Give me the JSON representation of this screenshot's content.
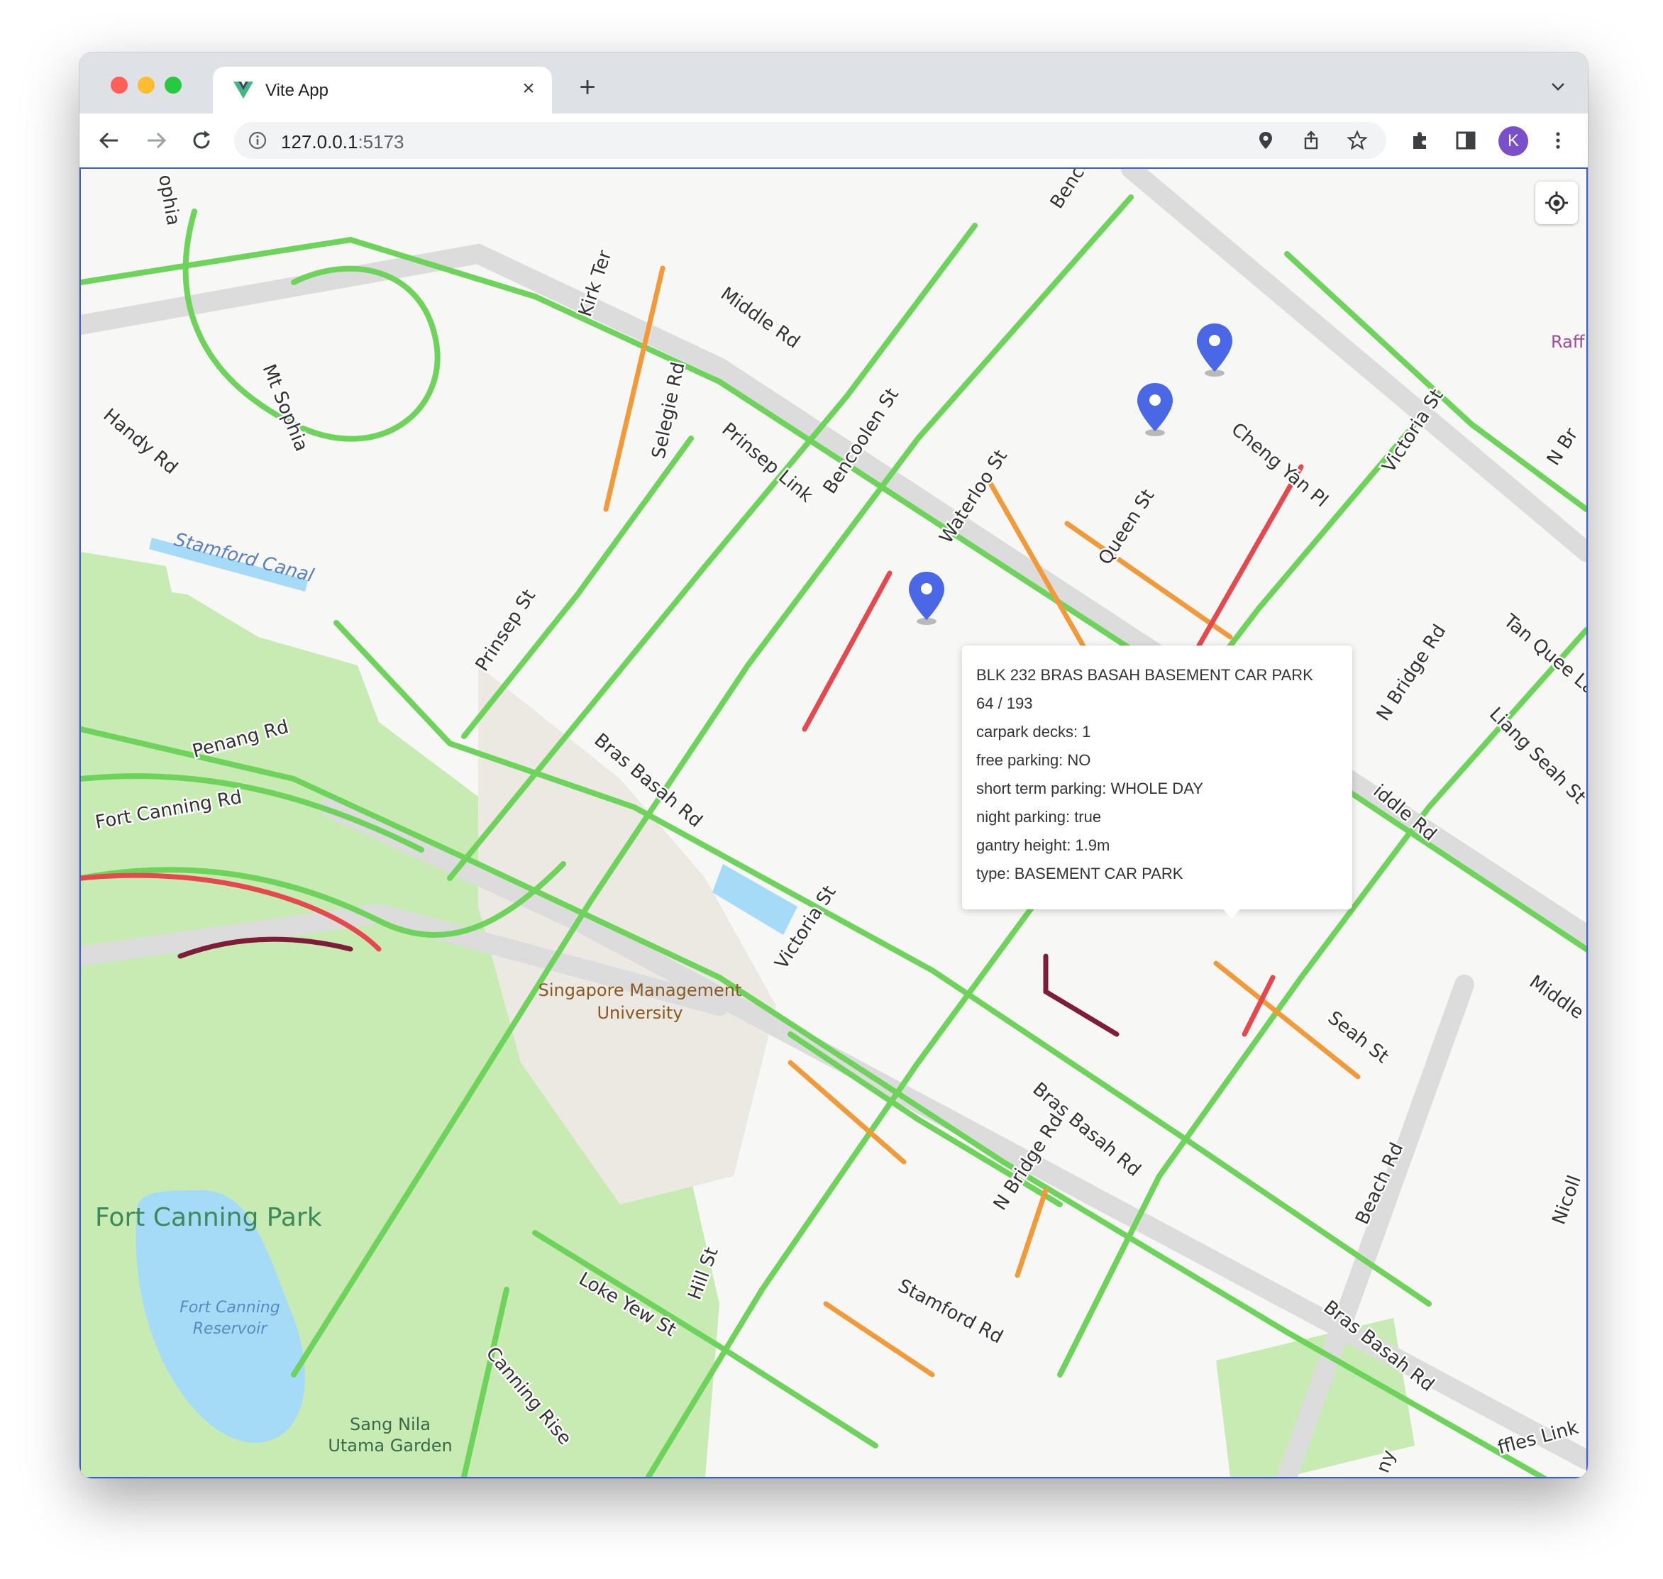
{
  "browser": {
    "tab": {
      "title": "Vite App",
      "close_glyph": "×",
      "favicon": "vue-logo-icon"
    },
    "new_tab_glyph": "+",
    "url_host": "127.0.0.1",
    "url_port": ":5173",
    "profile_initial": "K"
  },
  "map": {
    "street_labels": {
      "middle_rd": "Middle Rd",
      "middle_rd_right": "Middle",
      "middle_rd_mid": "iddle Rd",
      "bencoolen_st": "Bencoolen St",
      "bencoolen_top": "Benco",
      "selegie_rd": "Selegie Rd",
      "kirk_ter": "Kirk Ter",
      "prinsep_link": "Prinsep Link",
      "prinsep_st": "Prinsep St",
      "waterloo_st": "Waterloo St",
      "queen_st": "Queen St",
      "cheng_yan_pl": "Cheng Yan Pl",
      "victoria_st": "Victoria St",
      "victoria_st_lower": "Victoria St",
      "n_bridge_rd": "N Bridge Rd",
      "n_bridge_rd_lower": "N Bridge Rd",
      "n_br": "N Br",
      "tan_quee_lan": "Tan Quee Lan",
      "liang_seah_st": "Liang Seah St",
      "bras_basah_rd_1": "Bras Basah Rd",
      "bras_basah_rd_2": "Bras Basah Rd",
      "bras_basah_rd_3": "Bras Basah Rd",
      "seah_st": "Seah St",
      "beach_rd": "Beach Rd",
      "nicoll": "Nicoll",
      "stamford_rd": "Stamford Rd",
      "hill_st": "Hill St",
      "loke_yew_st": "Loke Yew St",
      "canning_rise": "Canning Rise",
      "fort_canning_rd": "Fort Canning Rd",
      "penang_rd": "Penang Rd",
      "handy_rd": "Handy Rd",
      "mt_sophia": "Mt Sophia",
      "sophia": "ophia",
      "stamford_canal": "Stamford Canal",
      "raffles_link": "ffles Link",
      "raff": "Raff",
      "ny": "ny"
    },
    "poi_labels": {
      "smu_line1": "Singapore Management",
      "smu_line2": "University",
      "fort_canning_park": "Fort Canning Park",
      "reservoir_line1": "Fort Canning",
      "reservoir_line2": "Reservoir",
      "sang_nila_line1": "Sang Nila",
      "sang_nila_line2": "Utama Garden"
    },
    "markers": [
      "map-pin-icon",
      "map-pin-icon",
      "map-pin-icon"
    ],
    "colors": {
      "traffic_free": "#6ed35a",
      "traffic_moderate": "#f29a3a",
      "traffic_heavy": "#e5484d",
      "traffic_severe": "#7d1d3a",
      "marker": "#4a68e6",
      "park": "#c8ebb3",
      "water": "#a6dbf7"
    }
  },
  "popup": {
    "name": "BLK 232 BRAS BASAH BASEMENT CAR PARK",
    "availability": "64 / 193",
    "carpark_decks": "carpark decks: 1",
    "free_parking": "free parking: NO",
    "short_term_parking": "short term parking: WHOLE DAY",
    "night_parking": "night parking: true",
    "gantry_height": "gantry height: 1.9m",
    "type": "type: BASEMENT CAR PARK"
  }
}
